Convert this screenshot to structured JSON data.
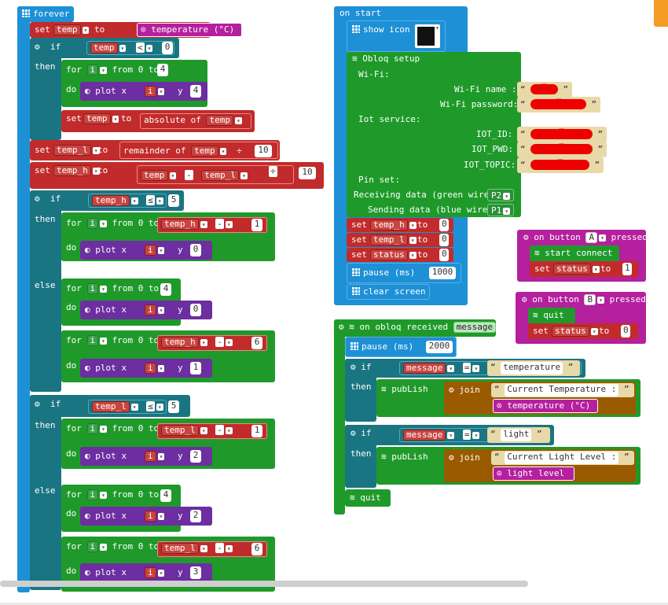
{
  "forever": {
    "title": "forever",
    "set_temp": {
      "set": "set",
      "var": "temp",
      "to": "to",
      "sensor": "temperature (°C)"
    },
    "if1": {
      "if": "if",
      "var": "temp",
      "op": "<",
      "num": "0",
      "then": "then",
      "for_var": "i",
      "for_from": "from 0 to",
      "for_num": "4",
      "do": "do",
      "plot": "plot x",
      "plot_var": "i",
      "plot_y": "y",
      "plot_num": "4",
      "set": "set",
      "set_var": "temp",
      "to": "to",
      "abs": "absolute of",
      "abs_var": "temp"
    },
    "set_temp_l": {
      "set": "set",
      "var": "temp_l",
      "to": "to",
      "rem": "remainder of",
      "rem_var": "temp",
      "op": "÷",
      "num": "10"
    },
    "set_temp_h": {
      "set": "set",
      "var": "temp_h",
      "to": "to",
      "a": "temp",
      "op": "-",
      "b": "temp_l",
      "div": "÷",
      "num": "10"
    },
    "if2": {
      "if": "if",
      "var": "temp_h",
      "op": "≤",
      "num": "5",
      "then": "then",
      "else": "else",
      "for1_var": "i",
      "for1_from": "from 0 to",
      "for1_a": "temp_h",
      "for1_op": "-",
      "for1_num": "1",
      "do": "do",
      "plot": "plot x",
      "plot1_var": "i",
      "plot1_y": "y",
      "plot1_num": "0",
      "for2_var": "i",
      "for2_from": "from 0 to",
      "for2_num": "4",
      "plot2_var": "i",
      "plot2_num": "0",
      "for3_var": "i",
      "for3_from": "from 0 to",
      "for3_a": "temp_h",
      "for3_op": "-",
      "for3_num": "6",
      "plot3_var": "i",
      "plot3_num": "1"
    },
    "if3": {
      "if": "if",
      "var": "temp_l",
      "op": "≤",
      "num": "5",
      "then": "then",
      "else": "else",
      "for1_var": "i",
      "for1_from": "from 0 to",
      "for1_a": "temp_l",
      "for1_op": "-",
      "for1_num": "1",
      "do": "do",
      "plot": "plot x",
      "plot1_var": "i",
      "plot1_y": "y",
      "plot1_num": "2",
      "for2_var": "i",
      "for2_from": "from 0 to",
      "for2_num": "4",
      "plot2_var": "i",
      "plot2_num": "2",
      "for3_var": "i",
      "for3_from": "from 0 to",
      "for3_a": "temp_l",
      "for3_op": "-",
      "for3_num": "6",
      "plot3_var": "i",
      "plot3_num": "3"
    }
  },
  "on_start": {
    "title": "on start",
    "show_icon": "show icon",
    "obloq": {
      "title": "Obloq setup",
      "wifi": "Wi-Fi:",
      "wifi_name": "Wi-Fi name :",
      "wifi_pw": "Wi-Fi password:",
      "iot": "Iot service:",
      "iot_id": "IOT_ID:",
      "iot_pwd": "IOT_PWD:",
      "iot_topic": "IOT_TOPIC:",
      "pin": "Pin set:",
      "recv": "Receiving data (green wire):",
      "recv_pin": "P2",
      "send": "Sending data (blue wire):",
      "send_pin": "P1"
    },
    "sets": [
      {
        "set": "set",
        "var": "temp_h",
        "to": "to",
        "num": "0"
      },
      {
        "set": "set",
        "var": "temp_l",
        "to": "to",
        "num": "0"
      },
      {
        "set": "set",
        "var": "status",
        "to": "to",
        "num": "0"
      }
    ],
    "pause": "pause (ms)",
    "pause_num": "1000",
    "clear": "clear screen"
  },
  "button_a": {
    "on": "on button",
    "btn": "A",
    "pressed": "pressed",
    "connect": "start connect",
    "set": "set",
    "var": "status",
    "to": "to",
    "num": "1"
  },
  "button_b": {
    "on": "on button",
    "btn": "B",
    "pressed": "pressed",
    "quit": "quit",
    "set": "set",
    "var": "status",
    "to": "to",
    "num": "0"
  },
  "received": {
    "title": "on obloq received",
    "param": "message",
    "pause": "pause (ms)",
    "pause_num": "2000",
    "if1": {
      "if": "if",
      "var": "message",
      "op": "=",
      "str": "temperature",
      "then": "then",
      "publish": "pubLish",
      "join": "join",
      "s1": "Current Temperature : ",
      "s2": "temperature (°C)"
    },
    "if2": {
      "if": "if",
      "var": "message",
      "op": "=",
      "str": "light",
      "then": "then",
      "publish": "pubLish",
      "join": "join",
      "s1": "Current Light Level : ",
      "s2": "light level"
    },
    "quit": "quit"
  }
}
